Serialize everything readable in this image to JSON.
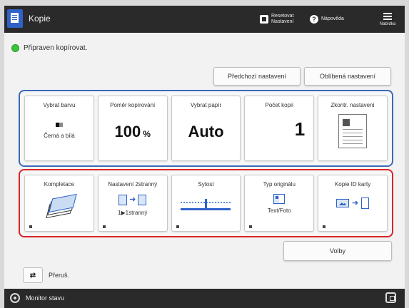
{
  "header": {
    "title": "Kopie",
    "reset_label": "Resetovat Nastavení",
    "help_label": "Nápověda",
    "menu_label": "Nabídka",
    "app_icon": "copy-app-icon"
  },
  "status": {
    "text": "Připraven kopírovat.",
    "color": "#3cc43c"
  },
  "top_buttons": {
    "previous": "Předchozí nastavení",
    "favorites": "Oblíbená nastavení"
  },
  "settings_main": [
    {
      "label": "Vybrat barvu",
      "value": "Černá a bílá",
      "icon": "black-white-icon"
    },
    {
      "label": "Poměr kopírování",
      "value": "100",
      "unit": "%"
    },
    {
      "label": "Vybrat papír",
      "value": "Auto"
    },
    {
      "label": "Počet kopií",
      "value": "1"
    },
    {
      "label": "Zkontr. nastavení",
      "icon": "document-preview-icon"
    }
  ],
  "settings_functions": [
    {
      "label": "Kompletace",
      "icon": "collate-stack-icon"
    },
    {
      "label": "Nastavení 2stranný",
      "value": "1▶1stranný",
      "icon": "duplex-icon"
    },
    {
      "label": "Sytost",
      "icon": "density-slider-icon"
    },
    {
      "label": "Typ originálu",
      "value": "Text/Foto",
      "icon": "original-type-icon"
    },
    {
      "label": "Kopie ID karty",
      "icon": "id-card-copy-icon"
    }
  ],
  "options_label": "Volby",
  "interrupt": {
    "label": "Přeruš.",
    "icon_text": "⇄"
  },
  "footer": {
    "label": "Monitor stavu"
  },
  "colors": {
    "header_bg": "#2a2a2a",
    "group_main_border": "#3b6ab8",
    "group_functions_border": "#d8242a",
    "accent": "#2f62c8"
  }
}
